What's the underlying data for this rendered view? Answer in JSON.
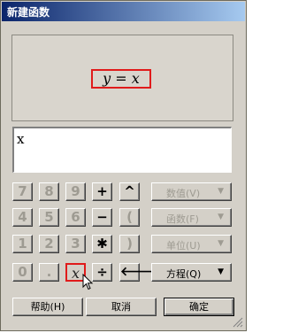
{
  "window": {
    "title": "新建函数"
  },
  "preview": {
    "formula": "y = x"
  },
  "editor": {
    "value": "x"
  },
  "keypad": {
    "rows": [
      [
        "7",
        "8",
        "9",
        "+",
        "^"
      ],
      [
        "4",
        "5",
        "6",
        "−",
        "("
      ],
      [
        "1",
        "2",
        "3",
        "✱",
        ")"
      ],
      [
        "0",
        ".",
        "x",
        "÷",
        "🡐"
      ]
    ]
  },
  "menus": {
    "value": "数值(V)",
    "function": "函数(F)",
    "unit": "单位(U)",
    "equation": "方程(Q)"
  },
  "buttons": {
    "help": "帮助(H)",
    "cancel": "取消",
    "ok": "确定"
  },
  "colors": {
    "titlebar_start": "#0a246a",
    "titlebar_end": "#a6caf0",
    "highlight": "#e01b1b"
  }
}
